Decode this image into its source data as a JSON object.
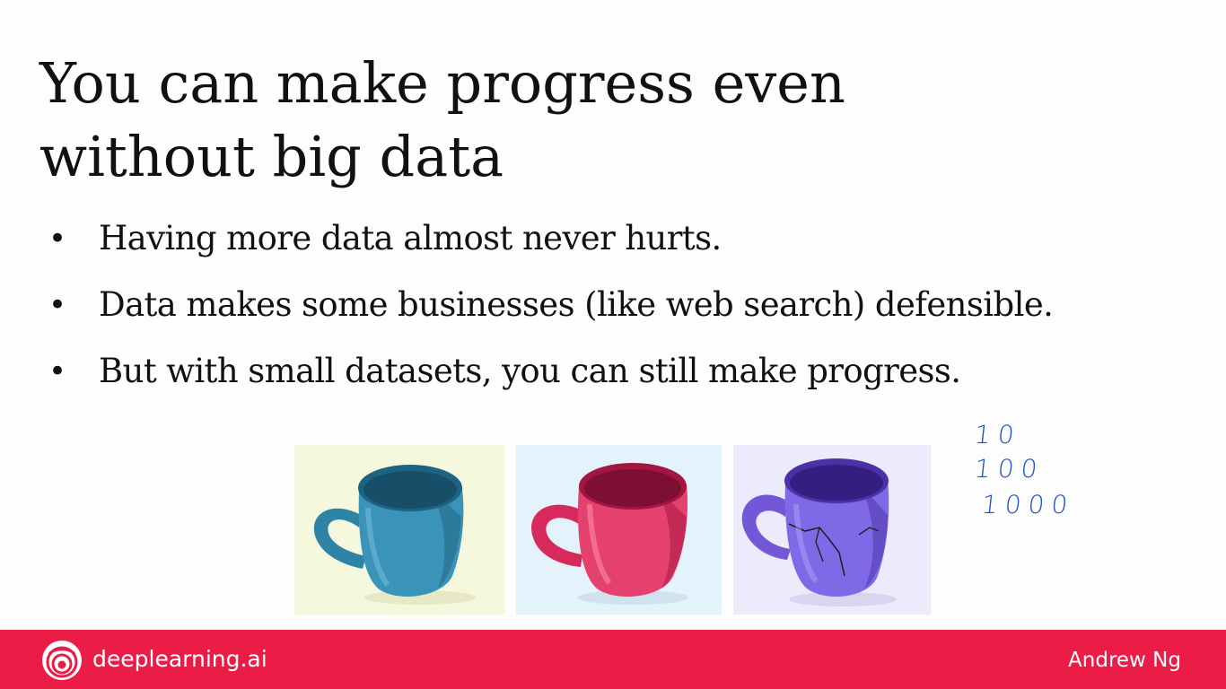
{
  "slide": {
    "title_line1": "You can make progress even",
    "title_line2": "without big data",
    "bullet_glyph": "•",
    "bullets": [
      "Having more data almost never hurts.",
      "Data makes some businesses (like web search) defensible.",
      "But with small datasets, you can still make progress."
    ],
    "images": [
      {
        "name": "blue mug",
        "mug_color": "#3a8fb0",
        "background": "#f6f8dd"
      },
      {
        "name": "pink mug",
        "mug_color": "#e03a6a",
        "background": "#e4f2fb"
      },
      {
        "name": "purple cracked mug",
        "mug_color": "#7b63e0",
        "background": "#ecebfb"
      }
    ],
    "handwritten_notes": [
      "10",
      "100",
      "1000"
    ]
  },
  "footer": {
    "brand": "deeplearning.ai",
    "author": "Andrew Ng",
    "background": "#eb1c45",
    "logo_icon": "deeplearning-logo-icon"
  }
}
